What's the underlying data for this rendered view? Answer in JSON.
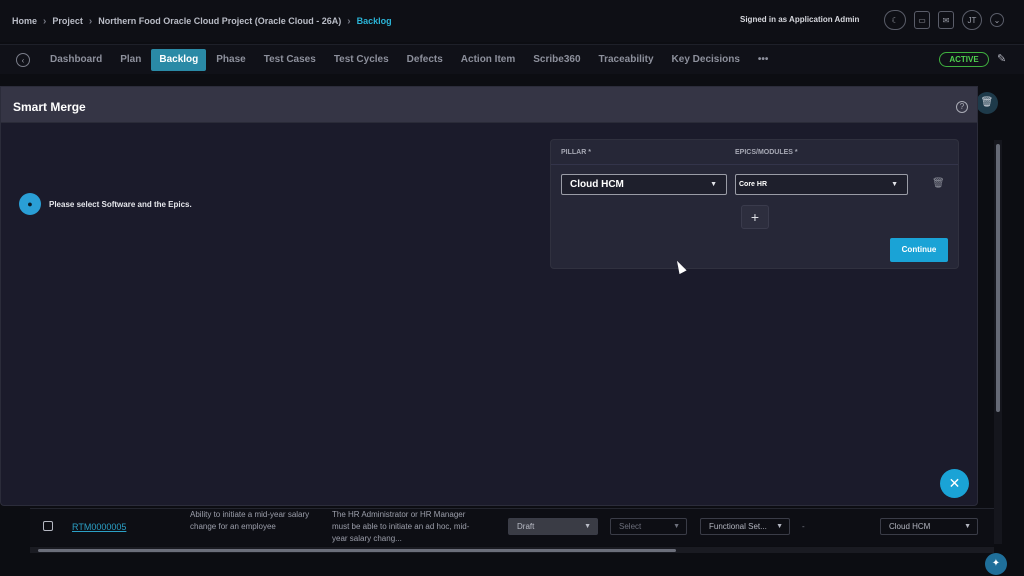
{
  "breadcrumb": [
    "Home",
    "Project",
    "Northern Food Oracle Cloud Project (Oracle Cloud - 26A)",
    "Backlog"
  ],
  "signed_in": "Signed in as Application Admin",
  "user_initials": "JT",
  "tabs": [
    "Dashboard",
    "Plan",
    "Backlog",
    "Phase",
    "Test Cases",
    "Test Cycles",
    "Defects",
    "Action Item",
    "Scribe360",
    "Traceability",
    "Key Decisions"
  ],
  "more_tabs": "•••",
  "status_badge": "ACTIVE",
  "modal": {
    "title": "Smart Merge",
    "info_message": "Please select Software and the Epics.",
    "pillar_header": "PILLAR *",
    "epics_header": "EPICS/MODULES *",
    "pillar_value": "Cloud HCM",
    "epics_value": "Core HR",
    "add_label": "+",
    "continue_label": "Continue",
    "close_label": "✕",
    "help_label": "?"
  },
  "background_row": {
    "id": "RTM0000005",
    "title": "Ability to initiate a mid-year salary change for an employee",
    "description": "The HR Administrator or HR Manager must be able to initiate an ad hoc, mid-year salary chang...",
    "status": "Draft",
    "priority": "Select",
    "type": "Functional Set...",
    "dash": "-",
    "pillar": "Cloud HCM"
  },
  "icons": {
    "theme_toggle": "moon-icon",
    "document": "document-icon",
    "mail": "mail-icon",
    "chevron": "chevron-down-icon",
    "edit": "pencil-icon",
    "trash": "trash-icon",
    "help": "help-circle-icon"
  },
  "colors": {
    "accent": "#1aa3d6",
    "active_tab": "#2a8aa6",
    "status_green": "#4fd04f"
  }
}
